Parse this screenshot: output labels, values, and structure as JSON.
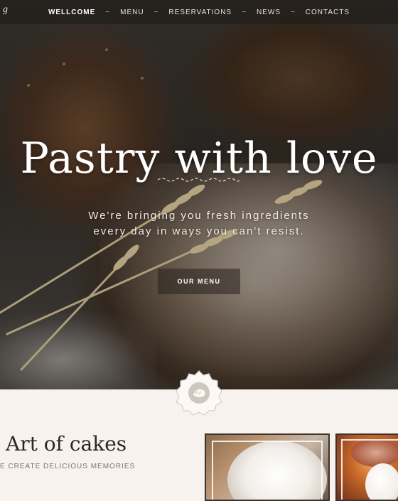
{
  "nav": {
    "logo_fragment": "g",
    "items": [
      {
        "label": "WELLCOME",
        "active": true
      },
      {
        "label": "MENU",
        "active": false
      },
      {
        "label": "RESERVATIONS",
        "active": false
      },
      {
        "label": "NEWS",
        "active": false
      },
      {
        "label": "CONTACTS",
        "active": false
      }
    ],
    "separator": "~"
  },
  "hero": {
    "title": "Pastry with love",
    "subtitle_line1": "We're bringing you fresh ingredients",
    "subtitle_line2": "every day in ways you can't resist.",
    "button_label": "OUR MENU",
    "divider_icon": "ornamental-squiggle-icon"
  },
  "badge": {
    "icon": "bakery-logo-icon"
  },
  "section": {
    "title": "Art of cakes",
    "subtitle": "E CREATE DELICIOUS MEMORIES"
  },
  "colors": {
    "title_text": "#ffffff",
    "dark_text": "#2b2623",
    "muted_text": "#7b736c",
    "page_bg": "#f7f2ee"
  }
}
